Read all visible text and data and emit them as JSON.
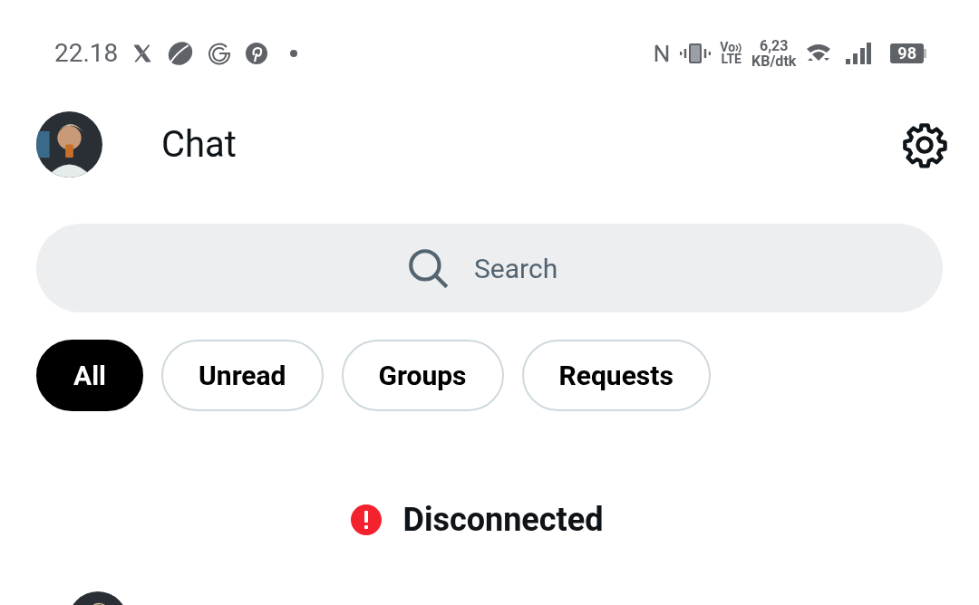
{
  "status_bar": {
    "time": "22.18",
    "volte": {
      "top": "Vo",
      "bottom": "LTE"
    },
    "network_speed": {
      "value": "6,23",
      "unit": "KB/dtk"
    },
    "battery": "98"
  },
  "header": {
    "title": "Chat"
  },
  "search": {
    "placeholder": "Search"
  },
  "filters": [
    {
      "label": "All",
      "selected": true
    },
    {
      "label": "Unread",
      "selected": false
    },
    {
      "label": "Groups",
      "selected": false
    },
    {
      "label": "Requests",
      "selected": false
    }
  ],
  "connection": {
    "status": "Disconnected"
  }
}
